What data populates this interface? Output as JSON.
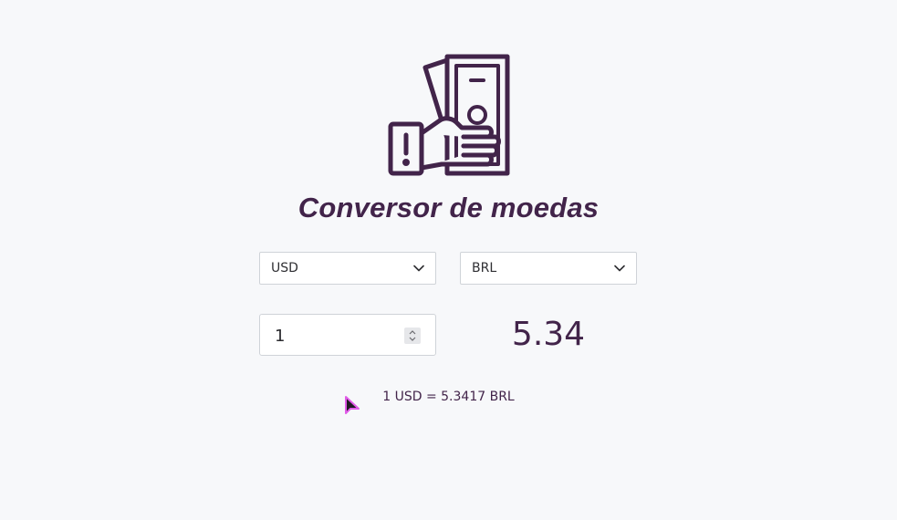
{
  "app": {
    "title": "Conversor de moedas"
  },
  "converter": {
    "from_currency": "USD",
    "to_currency": "BRL",
    "amount": "1",
    "result": "5.34",
    "rate_text": "1 USD = 5.3417 BRL"
  },
  "icons": {
    "logo": "money-in-hand-icon",
    "dropdown": "chevron-down-icon",
    "stepper": "number-stepper-icon",
    "pointer": "mouse-cursor-icon"
  },
  "colors": {
    "primary": "#42244a",
    "background": "#f7f8fa",
    "field_border": "#cfd3d8"
  }
}
